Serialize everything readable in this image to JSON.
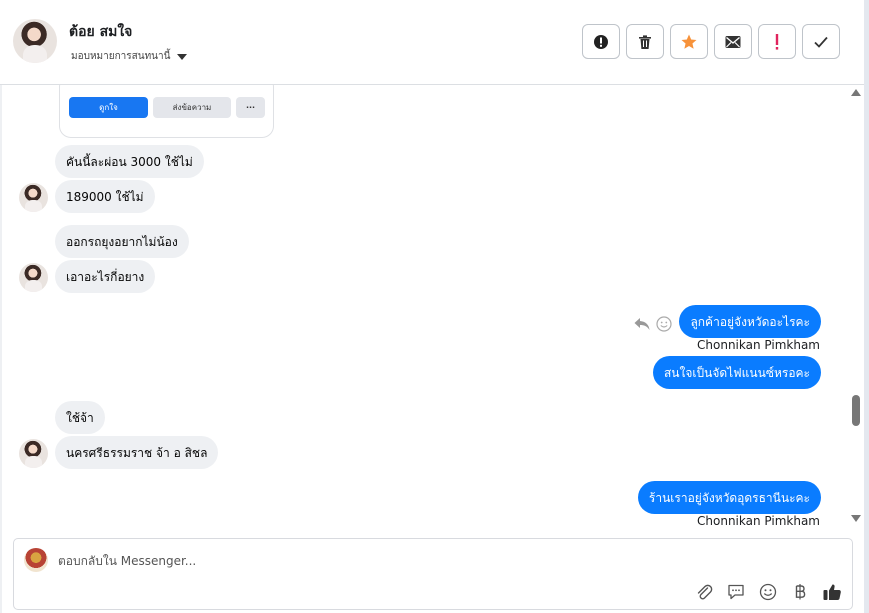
{
  "header": {
    "contact_name": "ต้อย สมใจ",
    "assign_label": "มอบหมายการสนทนานี้",
    "actions": [
      {
        "name": "spam-icon",
        "label": "mark spam"
      },
      {
        "name": "trash-icon",
        "label": "delete"
      },
      {
        "name": "star-icon",
        "label": "star"
      },
      {
        "name": "mail-icon",
        "label": "mark unread"
      },
      {
        "name": "exclamation-icon",
        "label": "follow up"
      },
      {
        "name": "check-icon",
        "label": "mark done"
      }
    ],
    "star_color": "#f7923a",
    "alert_color": "#e0245e"
  },
  "card": {
    "primary_label": "ดูกใจ",
    "secondary_label": "ส่งข้อความ",
    "more_label": "···"
  },
  "messages": {
    "m1": "คันนี้ละผ่อน 3000 ใช้ไม่",
    "m2": "189000 ใช้ไม่",
    "m3": "ออกรถยุงอยากไม่น้อง",
    "m4": "เอาอะไรกี่อยาง",
    "m5": "ลูกค้าอยู่จังหวัดอะไรคะ",
    "m6": "สนใจเป็นจัดไฟแนนซ์หรอคะ",
    "m7": "ใช้จ้า",
    "m8": "นครศรีธรรมราช จ้า อ สิชล",
    "m9": "ร้านเราอยู่จังหวัดอุดรธานีนะคะ"
  },
  "senders": {
    "s1": "Chonnikan Pimkham",
    "s2": "Chonnikan Pimkham"
  },
  "composer": {
    "placeholder": "ตอบกลับใน Messenger..."
  },
  "colors": {
    "outgoing_bubble": "#0a7cff",
    "incoming_bubble": "#eef0f3",
    "primary_button": "#1877f2"
  }
}
